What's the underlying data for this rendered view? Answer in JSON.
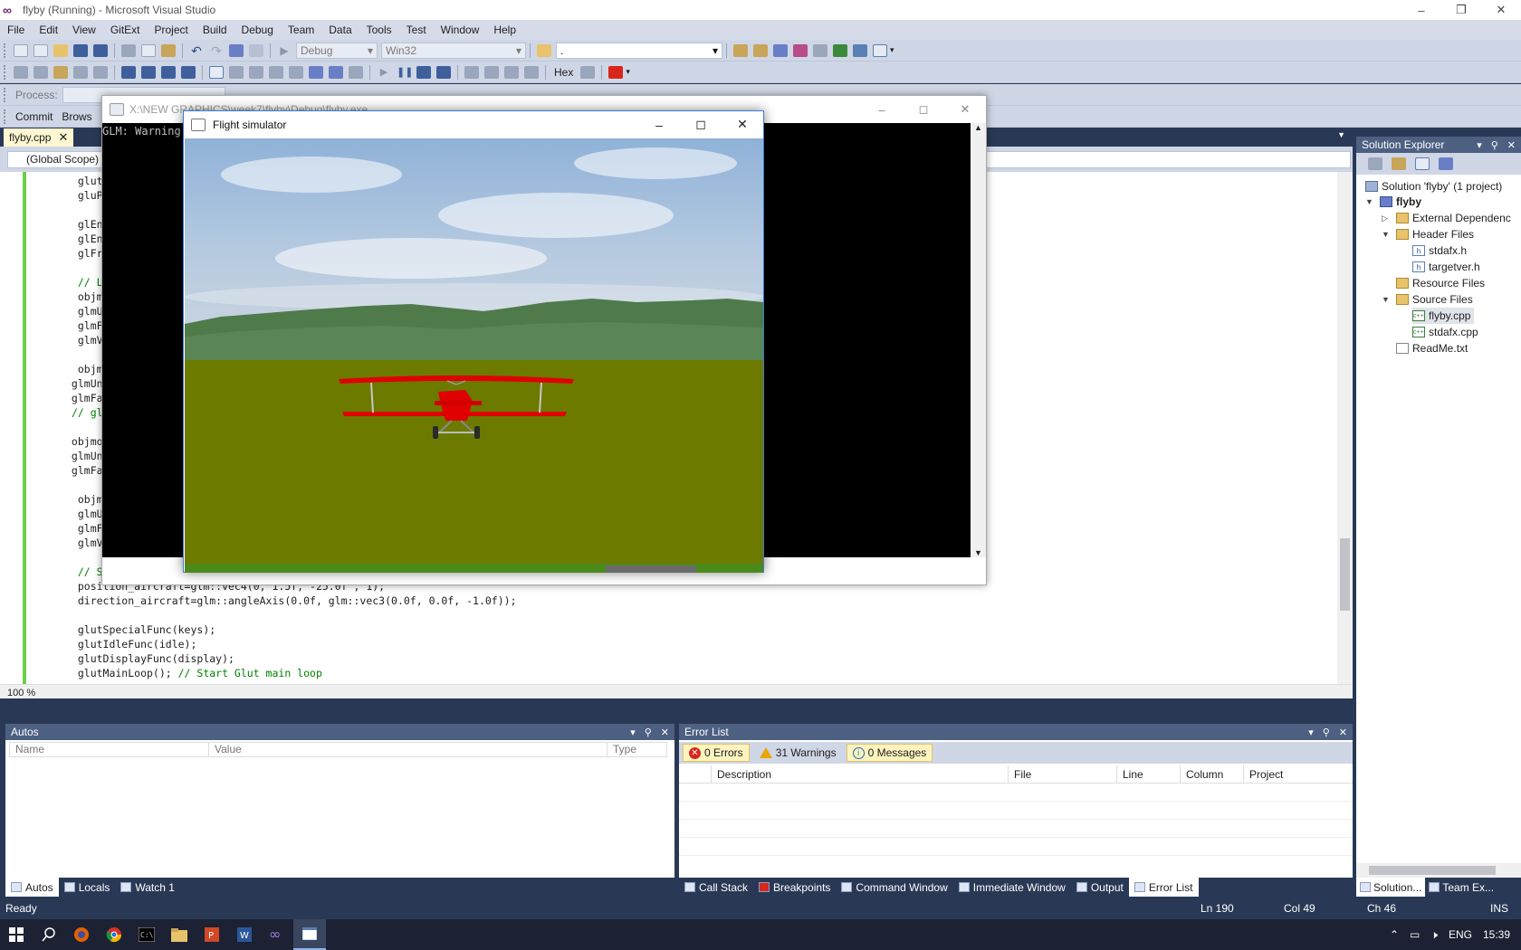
{
  "window": {
    "title": "flyby (Running) - Microsoft Visual Studio",
    "logo_glyph": "∞"
  },
  "menu": [
    "File",
    "Edit",
    "View",
    "GitExt",
    "Project",
    "Build",
    "Debug",
    "Team",
    "Data",
    "Tools",
    "Test",
    "Window",
    "Help"
  ],
  "toolbar": {
    "config": "Debug",
    "platform": "Win32",
    "find_value": ".",
    "hex_label": "Hex",
    "process_label": "Process:",
    "commit_label": "Commit",
    "browse_label": "Brows"
  },
  "editor": {
    "tab_label": "flyby.cpp",
    "scope": "(Global Scope)",
    "zoom": "100 %",
    "code_lines": [
      {
        "text": "  glut",
        "comment": ""
      },
      {
        "text": "  gluPe",
        "comment": ""
      },
      {
        "text": "",
        "comment": ""
      },
      {
        "text": "  glEna",
        "comment": ""
      },
      {
        "text": "  glEna",
        "comment": ""
      },
      {
        "text": "  glFro",
        "comment": ""
      },
      {
        "text": "",
        "comment": ""
      },
      {
        "text": "  ",
        "comment": "// Lo"
      },
      {
        "text": "  objmo",
        "comment": ""
      },
      {
        "text": "  glmUn",
        "comment": ""
      },
      {
        "text": "  glmFa",
        "comment": ""
      },
      {
        "text": "  glmVe",
        "comment": ""
      },
      {
        "text": "",
        "comment": ""
      },
      {
        "text": "  objmo",
        "comment": ""
      },
      {
        "text": " glmUni",
        "comment": ""
      },
      {
        "text": " glmFac",
        "comment": ""
      },
      {
        "text": " ",
        "comment": "// glm"
      },
      {
        "text": "",
        "comment": ""
      },
      {
        "text": " objmod",
        "comment": ""
      },
      {
        "text": " glmUni",
        "comment": ""
      },
      {
        "text": " glmFac",
        "comment": ""
      },
      {
        "text": "",
        "comment": ""
      },
      {
        "text": "  objmo",
        "comment": ""
      },
      {
        "text": "  glmUn",
        "comment": ""
      },
      {
        "text": "  glmFa",
        "comment": ""
      },
      {
        "text": "  glmVe",
        "comment": ""
      },
      {
        "text": "",
        "comment": ""
      },
      {
        "text": "  ",
        "comment": "// Starting positi"
      },
      {
        "text": "  position_aircraft=glm::vec4(0, 1.5f, -25.0f , 1);",
        "comment": ""
      },
      {
        "text": "  direction_aircraft=glm::angleAxis(0.0f, glm::vec3(0.0f, 0.0f, -1.0f));",
        "comment": ""
      },
      {
        "text": "",
        "comment": ""
      },
      {
        "text": "  glutSpecialFunc(keys);",
        "comment": ""
      },
      {
        "text": "  glutIdleFunc(idle);",
        "comment": ""
      },
      {
        "text": "  glutDisplayFunc(display);",
        "comment": ""
      },
      {
        "text": "  glutMainLoop(); ",
        "comment": "// Start Glut main loop"
      }
    ]
  },
  "console": {
    "title": "X:\\NEW GRAPHICS\\week7\\flyby\\Debug\\flyby.exe",
    "output": "GLM: Warning"
  },
  "flight": {
    "title": "Flight simulator",
    "colors": {
      "ground": "#6d7a00",
      "plane": "#e00000"
    }
  },
  "autos": {
    "title": "Autos",
    "columns": [
      "Name",
      "Value",
      "Type"
    ]
  },
  "error_list": {
    "title": "Error List",
    "errors": "0 Errors",
    "warnings": "31 Warnings",
    "messages": "0 Messages",
    "columns": [
      "Description",
      "File",
      "Line",
      "Column",
      "Project"
    ]
  },
  "bottom_tabs_left": [
    "Autos",
    "Locals",
    "Watch 1"
  ],
  "bottom_tabs_right": [
    "Call Stack",
    "Breakpoints",
    "Command Window",
    "Immediate Window",
    "Output",
    "Error List"
  ],
  "solution_explorer": {
    "title": "Solution Explorer",
    "items": [
      {
        "label": "Solution 'flyby' (1 project)",
        "icon": "solution-icon"
      },
      {
        "label": "flyby",
        "icon": "project-icon"
      },
      {
        "label": "External Dependenc",
        "icon": "folder-icon"
      },
      {
        "label": "Header Files",
        "icon": "folder-icon"
      },
      {
        "label": "stdafx.h",
        "icon": "header-file-icon"
      },
      {
        "label": "targetver.h",
        "icon": "header-file-icon"
      },
      {
        "label": "Resource Files",
        "icon": "folder-icon"
      },
      {
        "label": "Source Files",
        "icon": "folder-icon"
      },
      {
        "label": "flyby.cpp",
        "icon": "cpp-file-icon"
      },
      {
        "label": "stdafx.cpp",
        "icon": "cpp-file-icon"
      },
      {
        "label": "ReadMe.txt",
        "icon": "text-file-icon"
      }
    ],
    "tab_solution": "Solution...",
    "tab_team": "Team Ex..."
  },
  "status": {
    "state": "Ready",
    "line": "Ln 190",
    "col": "Col 49",
    "ch": "Ch 46",
    "mode": "INS"
  },
  "taskbar": {
    "language": "ENG",
    "time": "15:39"
  }
}
